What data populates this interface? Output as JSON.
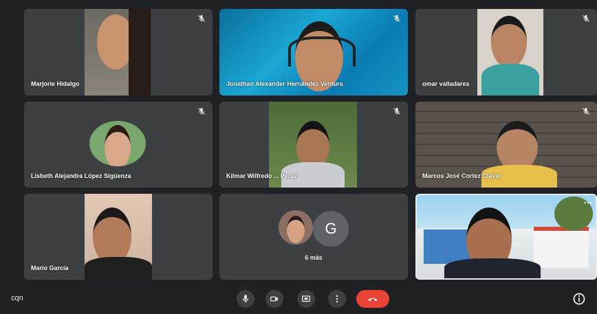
{
  "meeting": {
    "code": "cqn",
    "participants": [
      {
        "name": "Marjorie Hidalgo",
        "muted": true
      },
      {
        "name": "Jonathan Alexander Hernández Ventura",
        "muted": true
      },
      {
        "name": "omar valladares",
        "muted": true
      },
      {
        "name": "Lisbeth Alejandra López Sigüenza",
        "muted": true
      },
      {
        "name": "Kilmar Wilfredo ... Pérez",
        "muted": true
      },
      {
        "name": "Marcos José Cortez Clavel",
        "muted": true
      },
      {
        "name": "Mario García",
        "muted": false
      }
    ],
    "more": {
      "avatar_letter": "G",
      "label": "6 más"
    }
  },
  "toolbar": {
    "mic_icon": "microphone-icon",
    "camera_icon": "camera-icon",
    "present_icon": "present-screen-icon",
    "more_icon": "more-vert-icon",
    "end_icon": "end-call-icon",
    "info_icon": "info-icon"
  },
  "colors": {
    "background": "#202124",
    "tile": "#3c4043",
    "end_call": "#ea4335"
  }
}
